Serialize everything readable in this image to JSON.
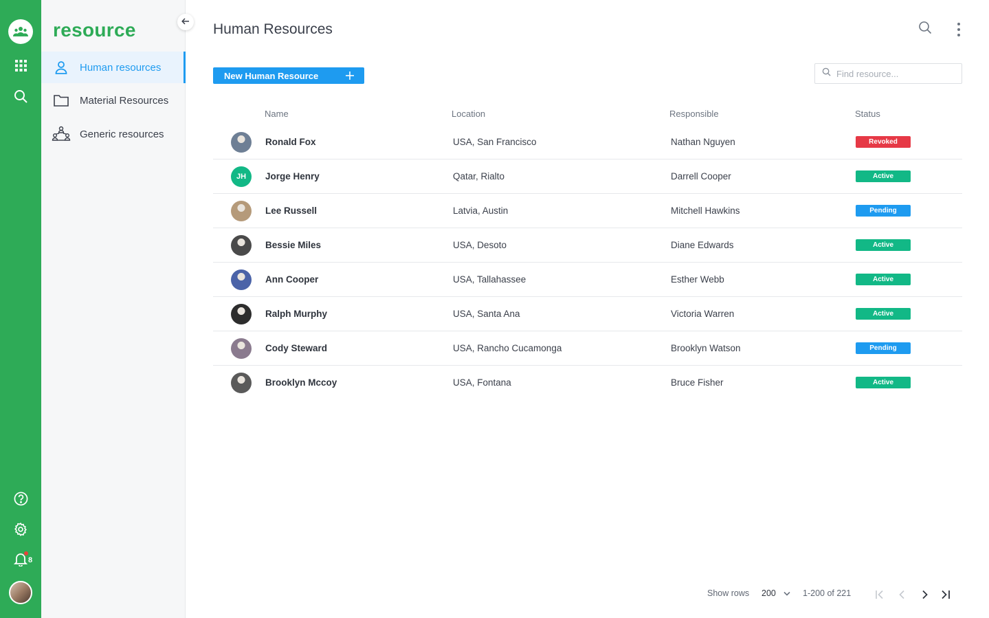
{
  "app": {
    "brand": "resource"
  },
  "colors": {
    "rail": "#2eab57",
    "accent": "#1e9bf0",
    "active": "#12b886",
    "pending": "#1e9bf0",
    "revoked": "#e63946"
  },
  "rail": {
    "icons": [
      "team-icon",
      "apps-grid-icon",
      "search-icon",
      "help-icon",
      "settings-icon",
      "bell-icon"
    ],
    "notification_count": "8"
  },
  "sidebar": {
    "items": [
      {
        "label": "Human resources",
        "icon": "person-icon",
        "active": true
      },
      {
        "label": "Material Resources",
        "icon": "folder-icon",
        "active": false
      },
      {
        "label": "Generic resources",
        "icon": "network-icon",
        "active": false
      }
    ]
  },
  "header": {
    "title": "Human Resources"
  },
  "toolbar": {
    "new_label": "New Human Resource",
    "search_placeholder": "Find resource..."
  },
  "table": {
    "columns": {
      "name": "Name",
      "location": "Location",
      "responsible": "Responsible",
      "status": "Status"
    },
    "rows": [
      {
        "name": "Ronald Fox",
        "location": "USA, San Francisco",
        "responsible": "Nathan Nguyen",
        "status": "Revoked",
        "initials": "",
        "avatar": "#6e7f95"
      },
      {
        "name": "Jorge Henry",
        "location": "Qatar, Rialto",
        "responsible": "Darrell Cooper",
        "status": "Active",
        "initials": "JH",
        "avatar": "#12b886"
      },
      {
        "name": "Lee Russell",
        "location": "Latvia, Austin",
        "responsible": "Mitchell Hawkins",
        "status": "Pending",
        "initials": "",
        "avatar": "#b59a7a"
      },
      {
        "name": "Bessie Miles",
        "location": "USA, Desoto",
        "responsible": "Diane Edwards",
        "status": "Active",
        "initials": "",
        "avatar": "#4a4a4a"
      },
      {
        "name": "Ann Cooper",
        "location": "USA, Tallahassee",
        "responsible": "Esther Webb",
        "status": "Active",
        "initials": "",
        "avatar": "#4b63a8"
      },
      {
        "name": "Ralph Murphy",
        "location": "USA, Santa Ana",
        "responsible": "Victoria Warren",
        "status": "Active",
        "initials": "",
        "avatar": "#2d2d2d"
      },
      {
        "name": "Cody Steward",
        "location": "USA, Rancho Cucamonga",
        "responsible": "Brooklyn Watson",
        "status": "Pending",
        "initials": "",
        "avatar": "#8a7a8e"
      },
      {
        "name": "Brooklyn Mccoy",
        "location": "USA, Fontana",
        "responsible": "Bruce Fisher",
        "status": "Active",
        "initials": "",
        "avatar": "#5a5a5a"
      }
    ]
  },
  "pagination": {
    "show_rows_label": "Show rows",
    "rows_value": "200",
    "range": "1-200 of 221"
  }
}
